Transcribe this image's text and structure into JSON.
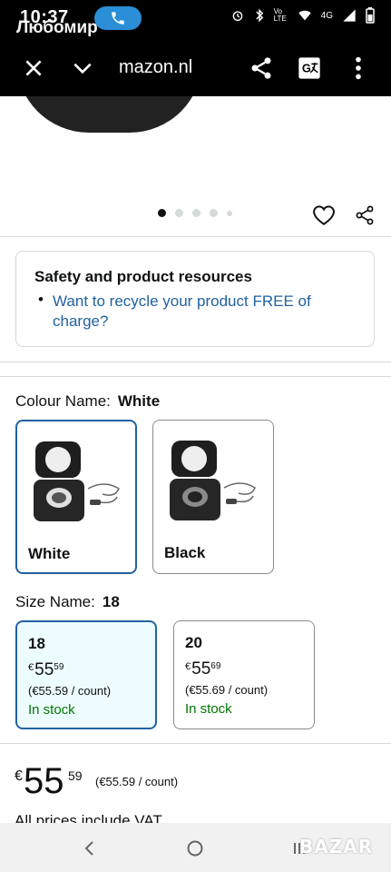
{
  "status_bar": {
    "time": "10:37",
    "overlay_name": "Любомир",
    "carrier": "4G",
    "volte": "Vo LTE"
  },
  "browser": {
    "url": "mazon.nl"
  },
  "gallery": {
    "dots": 5,
    "active_index": 0
  },
  "safety": {
    "title": "Safety and product resources",
    "link": "Want to recycle your product FREE of charge?"
  },
  "colour": {
    "label": "Colour Name:",
    "selected": "White",
    "options": [
      {
        "label": "White"
      },
      {
        "label": "Black"
      }
    ]
  },
  "size": {
    "label": "Size Name:",
    "selected": "18",
    "options": [
      {
        "name": "18",
        "currency": "€",
        "whole": "55",
        "fraction": "59",
        "unit": "(€55.59 / count)",
        "stock": "In stock"
      },
      {
        "name": "20",
        "currency": "€",
        "whole": "55",
        "fraction": "69",
        "unit": "(€55.69 / count)",
        "stock": "In stock"
      }
    ]
  },
  "price": {
    "currency": "€",
    "whole": "55",
    "fraction": "59",
    "unit": "(€55.59 / count)",
    "vat_note": "All prices include VAT"
  },
  "watermark": "BAZAR",
  "colors": {
    "link": "#2162a1",
    "stock": "#007600",
    "selected_border": "#2162a1",
    "selected_bg": "#edfdff"
  }
}
